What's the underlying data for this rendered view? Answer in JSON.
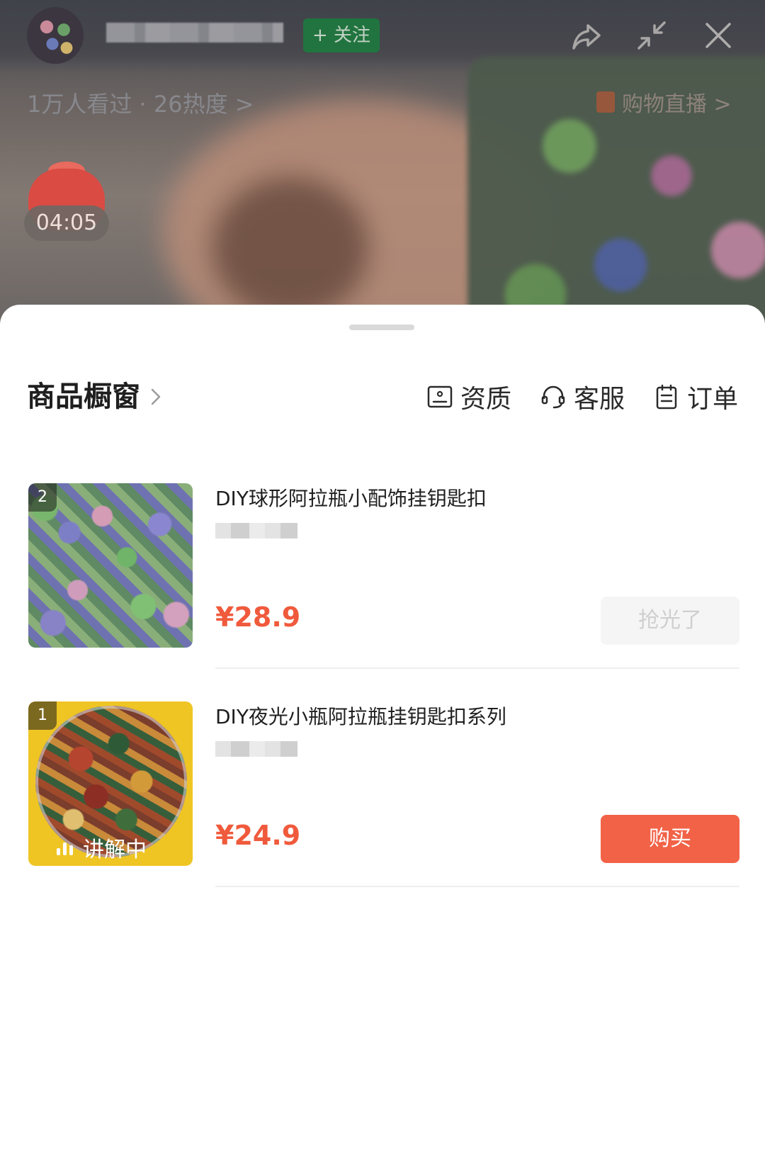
{
  "live": {
    "follow_label": "+ 关注",
    "viewer_stats": "1万人看过 · 26热度 >",
    "shopping_live": "购物直播 >",
    "red_bag_timer": "04:05"
  },
  "sheet": {
    "title": "商品橱窗",
    "actions": [
      {
        "label": "资质",
        "icon": "certificate-icon"
      },
      {
        "label": "客服",
        "icon": "headset-icon"
      },
      {
        "label": "订单",
        "icon": "clipboard-icon"
      }
    ]
  },
  "products": [
    {
      "rank": "2",
      "title": "DIY球形阿拉瓶小配饰挂钥匙扣",
      "price": "¥28.9",
      "button": "抢光了",
      "status": "sold-out"
    },
    {
      "rank": "1",
      "title": "DIY夜光小瓶阿拉瓶挂钥匙扣系列",
      "price": "¥24.9",
      "button": "购买",
      "badge": "讲解中",
      "status": "available"
    }
  ],
  "colors": {
    "accent": "#f26247",
    "price": "#f05a3c",
    "follow": "#1b7d3d"
  }
}
